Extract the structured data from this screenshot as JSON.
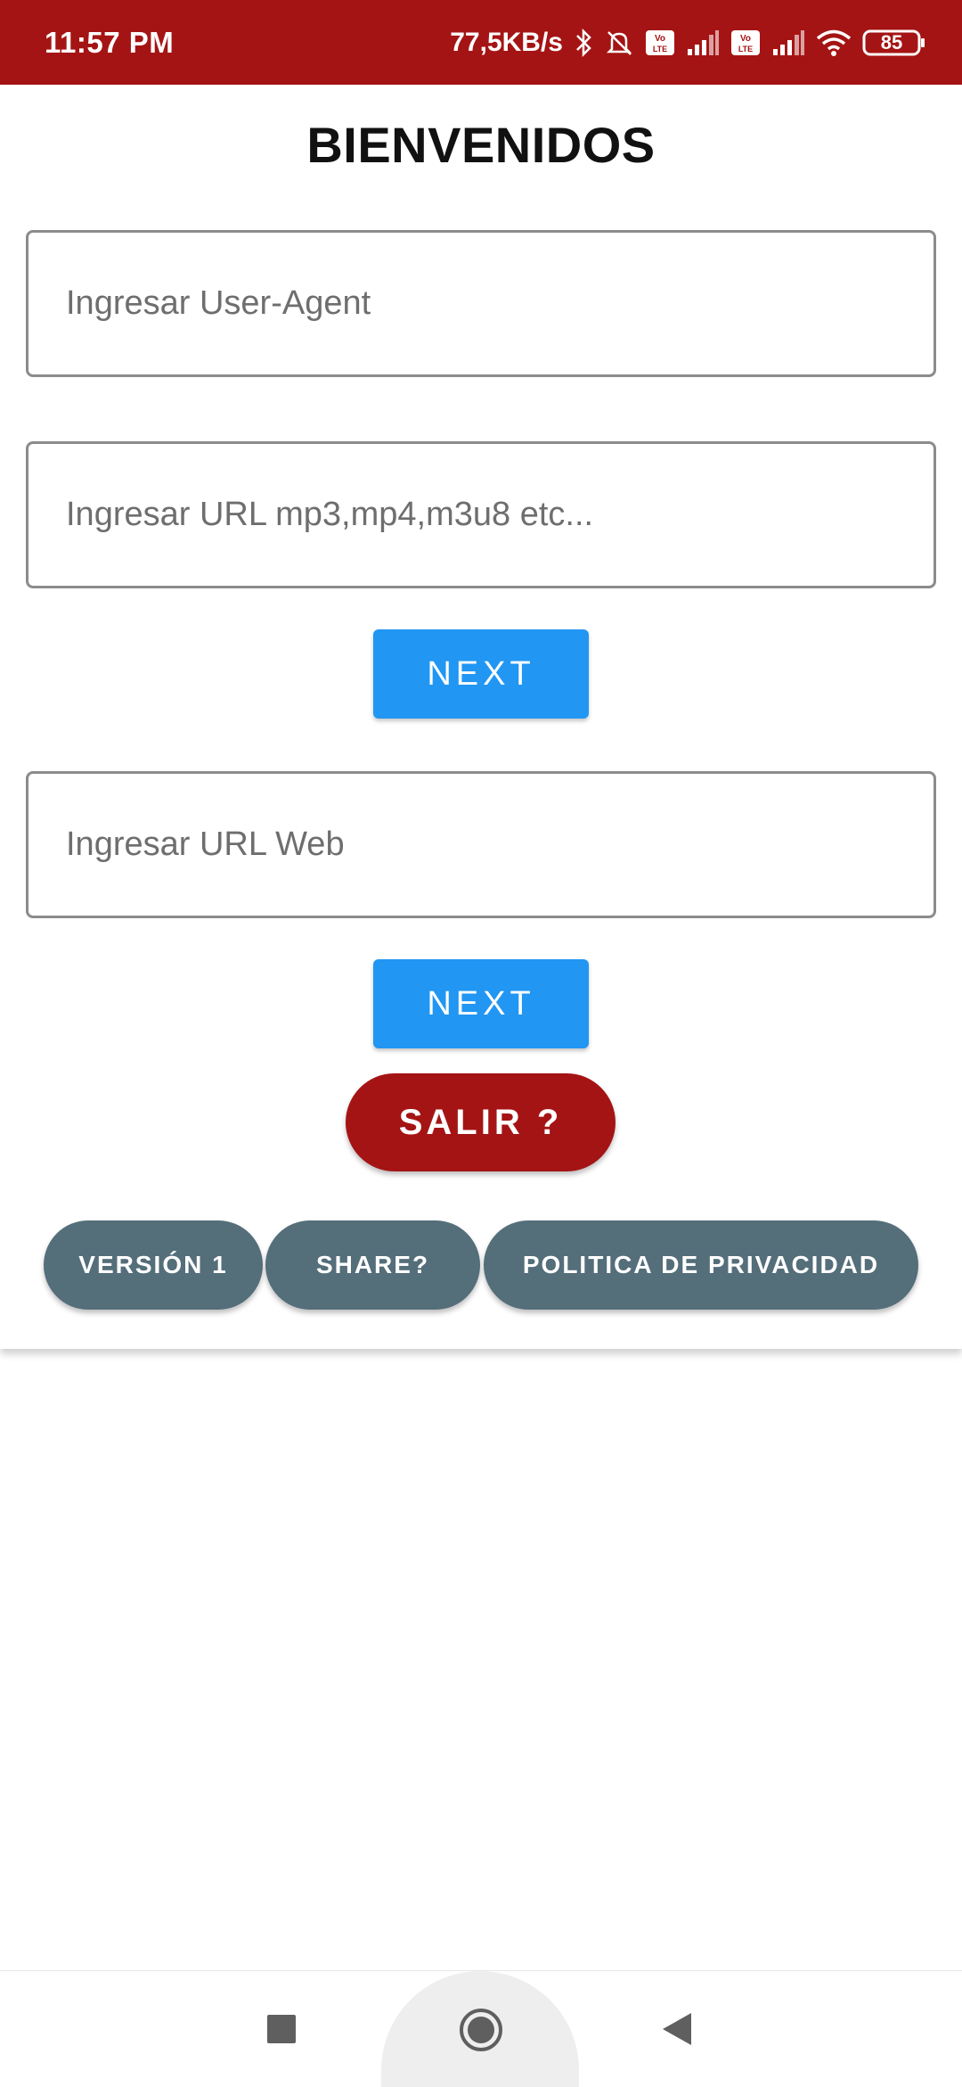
{
  "status_bar": {
    "time": "11:57 PM",
    "network_speed": "77,5KB/s",
    "battery": "85",
    "icons": [
      "bluetooth-icon",
      "bell-off-icon",
      "volte-icon",
      "signal-icon",
      "volte-icon",
      "signal-icon",
      "wifi-icon",
      "battery-icon"
    ]
  },
  "main": {
    "title": "BIENVENIDOS",
    "user_agent_placeholder": "Ingresar User-Agent",
    "url_media_placeholder": "Ingresar URL mp3,mp4,m3u8 etc...",
    "next_label_1": "NEXT",
    "url_web_placeholder": "Ingresar URL Web",
    "next_label_2": "NEXT",
    "exit_label": "SALIR ?"
  },
  "footer_buttons": {
    "version_label": "VERSIÓN 1",
    "share_label": "SHARE?",
    "privacy_label": "POLITICA DE PRIVACIDAD"
  },
  "nav_bar": {
    "icons": [
      "recents-square-icon",
      "home-circle-icon",
      "back-triangle-icon"
    ]
  },
  "colors": {
    "status_bar": "#a51414",
    "next_button": "#2196f3",
    "exit_button": "#a51414",
    "pill_button": "#546e7a"
  }
}
